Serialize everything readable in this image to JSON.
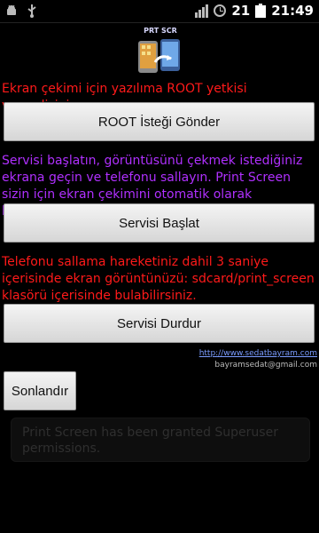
{
  "status": {
    "date": "21",
    "time": "21:49"
  },
  "logo": {
    "text": "PRT SCR"
  },
  "root_message": "Ekran çekimi için yazılıma ROOT yetkisi vermelisiniz.",
  "root_button": "ROOT İsteği Gönder",
  "start_message": "Servisi başlatın, görüntüsünü çekmek istediğiniz ekrana geçin ve telefonu sallayın. Print Screen sizin için ekran çekimini otomatik olarak kaydetsin.",
  "start_button": "Servisi Başlat",
  "shake_message": "Telefonu sallama hareketiniz dahil 3 saniye içerisinde ekran görüntünüzü: sdcard/print_screen klasörü içerisinde bulabilirsiniz.",
  "stop_button": "Servisi Durdur",
  "footer": {
    "link": "http://www.sedatbayram.com",
    "email": "bayramsedat@gmail.com"
  },
  "finish_button": "Sonlandır",
  "toast": "Print Screen has been granted Superuser permissions.",
  "colors": {
    "red_text": "#ff1a1a",
    "purple_text": "#b030ff",
    "link": "#7a9cff"
  }
}
